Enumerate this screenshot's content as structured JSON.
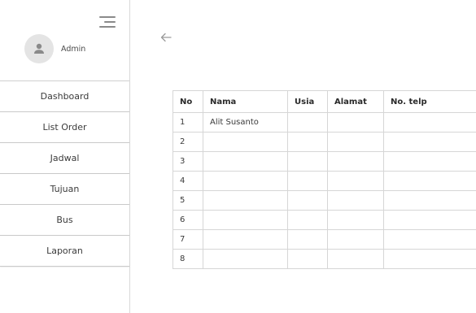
{
  "sidebar": {
    "user": {
      "name": "Admin"
    },
    "menu": [
      {
        "label": "Dashboard"
      },
      {
        "label": "List Order"
      },
      {
        "label": "Jadwal"
      },
      {
        "label": "Tujuan"
      },
      {
        "label": "Bus"
      },
      {
        "label": "Laporan"
      }
    ]
  },
  "table": {
    "headers": [
      "No",
      "Nama",
      "Usia",
      "Alamat",
      "No. telp"
    ],
    "rows": [
      [
        "1",
        "Alit Susanto",
        "",
        "",
        ""
      ],
      [
        "2",
        "",
        "",
        "",
        ""
      ],
      [
        "3",
        "",
        "",
        "",
        ""
      ],
      [
        "4",
        "",
        "",
        "",
        ""
      ],
      [
        "5",
        "",
        "",
        "",
        ""
      ],
      [
        "6",
        "",
        "",
        "",
        ""
      ],
      [
        "7",
        "",
        "",
        "",
        ""
      ],
      [
        "8",
        "",
        "",
        "",
        ""
      ]
    ]
  },
  "icons": {
    "menu": "hamburger-icon",
    "avatar": "user-icon",
    "back": "arrow-left-icon"
  },
  "colors": {
    "avatar_bg": "#e4e4e4",
    "icon_gray": "#8a8a8a",
    "border": "#d6d6d6"
  }
}
